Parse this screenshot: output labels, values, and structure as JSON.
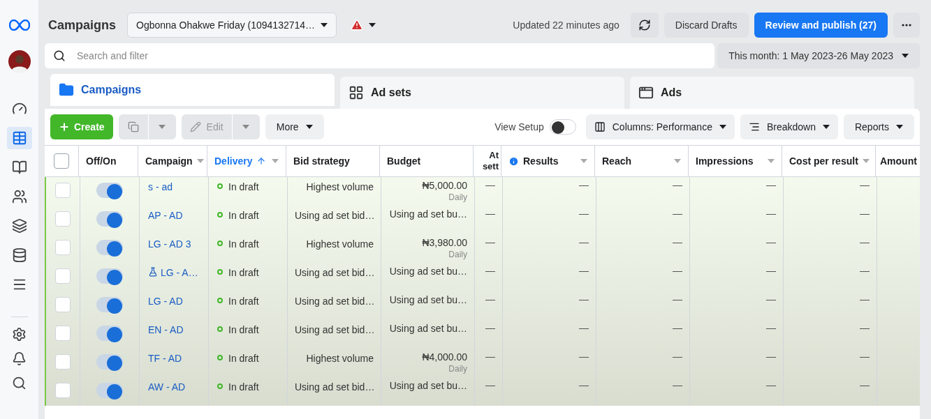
{
  "header": {
    "title": "Campaigns",
    "account": "Ogbonna Ohakwe Friday (1094132714…",
    "updated": "Updated 22 minutes ago",
    "discard": "Discard Drafts",
    "publish": "Review and publish (27)"
  },
  "sidebar": {
    "items": [
      {
        "kind": "gauge",
        "selected": false
      },
      {
        "kind": "table",
        "selected": true
      },
      {
        "kind": "pages",
        "selected": false
      },
      {
        "kind": "people",
        "selected": false
      },
      {
        "kind": "layers",
        "selected": false
      },
      {
        "kind": "coins",
        "selected": false
      },
      {
        "kind": "menu",
        "selected": false
      }
    ],
    "bottom": [
      {
        "kind": "settings"
      },
      {
        "kind": "bell"
      },
      {
        "kind": "search"
      }
    ]
  },
  "search": {
    "placeholder": "Search and filter"
  },
  "date_range": "This month: 1 May 2023-26 May 2023",
  "tabs": [
    {
      "label": "Campaigns",
      "kind": "folder",
      "selected": true
    },
    {
      "label": "Ad sets",
      "kind": "grid",
      "selected": false
    },
    {
      "label": "Ads",
      "kind": "window",
      "selected": false
    }
  ],
  "toolbar": {
    "create": "Create",
    "edit": "Edit",
    "more": "More",
    "view_setup": {
      "label": "View Setup",
      "on": false
    },
    "columns": "Columns: Performance",
    "breakdown": "Breakdown",
    "reports": "Reports"
  },
  "table": {
    "all_checked": false,
    "columns": [
      {
        "label": "Off/On",
        "kind": "text",
        "menu": false,
        "sorted": false,
        "info": false
      },
      {
        "label": "Campaign",
        "kind": "text",
        "menu": true,
        "sorted": false,
        "info": false
      },
      {
        "label": "Delivery",
        "kind": "text",
        "menu": true,
        "sorted": true,
        "info": false
      },
      {
        "label": "Bid strategy",
        "kind": "text",
        "menu": false,
        "sorted": false,
        "info": false
      },
      {
        "label": "Budget",
        "kind": "text",
        "menu": false,
        "sorted": false,
        "info": false
      },
      {
        "label": "At sett",
        "kind": "narrow",
        "sorted": false
      },
      {
        "label": "Results",
        "kind": "text",
        "menu": true,
        "sorted": false,
        "info": true
      },
      {
        "label": "Reach",
        "kind": "text",
        "menu": true,
        "sorted": false,
        "info": false
      },
      {
        "label": "Impressions",
        "kind": "text",
        "menu": true,
        "sorted": false,
        "info": false
      },
      {
        "label": "Cost per result",
        "kind": "text",
        "menu": true,
        "sorted": false,
        "info": false
      },
      {
        "label": "Amount",
        "kind": "edge",
        "sorted": false
      }
    ],
    "rows": [
      {
        "checked": false,
        "on": true,
        "experiment": false,
        "campaign": "s - ad",
        "delivery": "In draft",
        "bid_strategy": "Highest volume",
        "budget": "₦5,000.00",
        "budget_period": "Daily",
        "metrics": [
          "—",
          "—",
          "—",
          "—",
          "—"
        ]
      },
      {
        "checked": false,
        "on": true,
        "experiment": false,
        "campaign": "AP - AD",
        "delivery": "In draft",
        "bid_strategy": "Using ad set bid…",
        "budget": "Using ad set bu…",
        "metrics": [
          "—",
          "—",
          "—",
          "—",
          "—"
        ]
      },
      {
        "checked": false,
        "on": true,
        "experiment": false,
        "campaign": "LG - AD 3",
        "delivery": "In draft",
        "bid_strategy": "Highest volume",
        "budget": "₦3,980.00",
        "budget_period": "Daily",
        "metrics": [
          "—",
          "—",
          "—",
          "—",
          "—"
        ]
      },
      {
        "checked": false,
        "on": true,
        "experiment": true,
        "campaign": "LG - A…",
        "delivery": "In draft",
        "bid_strategy": "Using ad set bid…",
        "budget": "Using ad set bu…",
        "metrics": [
          "—",
          "—",
          "—",
          "—",
          "—"
        ]
      },
      {
        "checked": false,
        "on": true,
        "experiment": false,
        "campaign": "LG - AD",
        "delivery": "In draft",
        "bid_strategy": "Using ad set bid…",
        "budget": "Using ad set bu…",
        "metrics": [
          "—",
          "—",
          "—",
          "—",
          "—"
        ]
      },
      {
        "checked": false,
        "on": true,
        "experiment": false,
        "campaign": "EN - AD",
        "delivery": "In draft",
        "bid_strategy": "Using ad set bid…",
        "budget": "Using ad set bu…",
        "metrics": [
          "—",
          "—",
          "—",
          "—",
          "—"
        ]
      },
      {
        "checked": false,
        "on": true,
        "experiment": false,
        "campaign": "TF - AD",
        "delivery": "In draft",
        "bid_strategy": "Highest volume",
        "budget": "₦4,000.00",
        "budget_period": "Daily",
        "metrics": [
          "—",
          "—",
          "—",
          "—",
          "—"
        ]
      },
      {
        "checked": false,
        "on": true,
        "experiment": false,
        "campaign": "AW - AD",
        "delivery": "In draft",
        "bid_strategy": "Using ad set bid…",
        "budget": "Using ad set bu…",
        "metrics": [
          "—",
          "—",
          "—",
          "—",
          "—"
        ]
      }
    ]
  }
}
